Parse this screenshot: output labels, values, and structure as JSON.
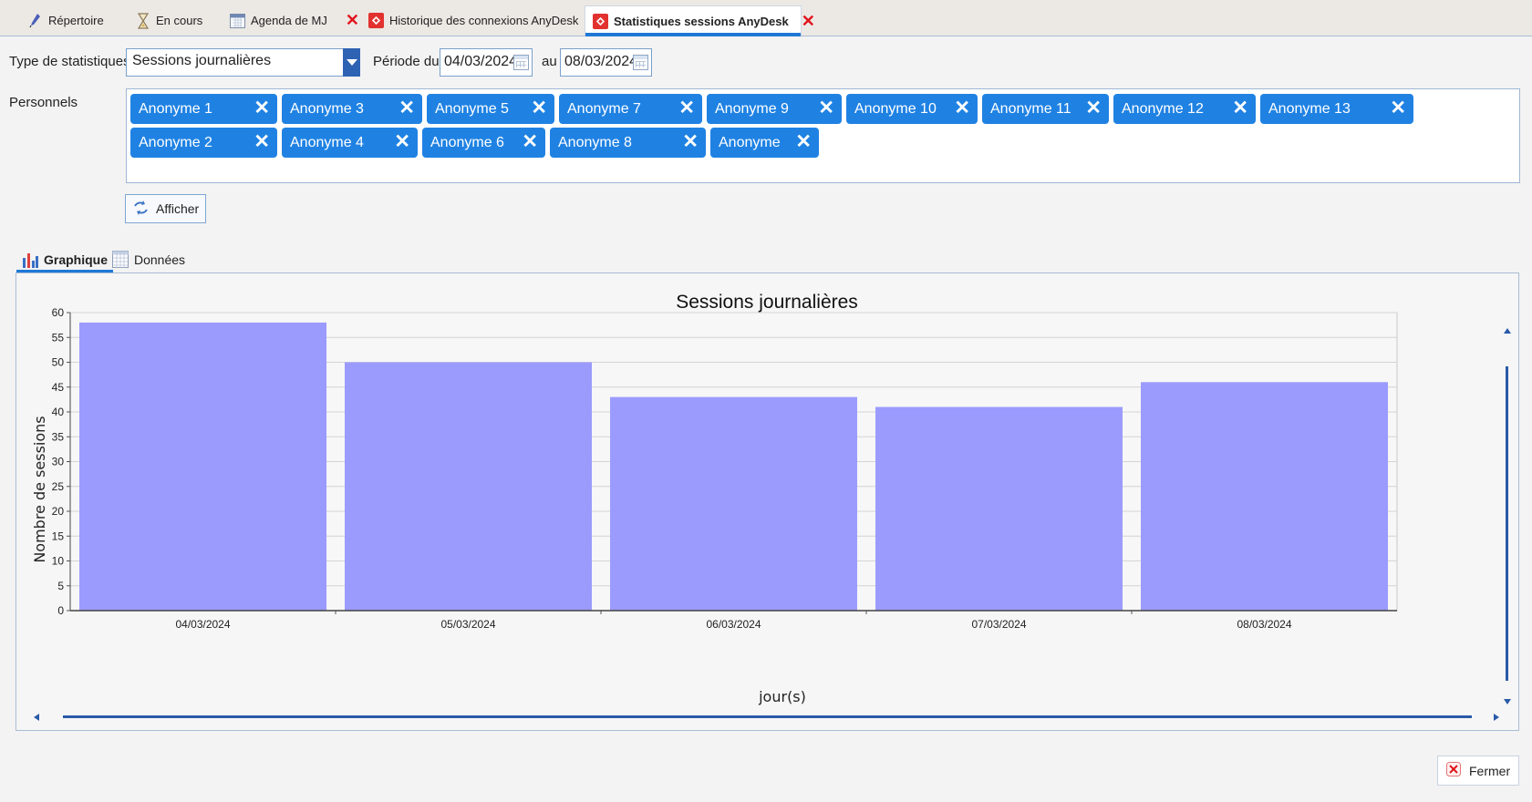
{
  "tabs": [
    {
      "label": "Répertoire",
      "icon": "pen-icon",
      "closable": false
    },
    {
      "label": "En cours",
      "icon": "hourglass-icon",
      "closable": false
    },
    {
      "label": "Agenda de MJ",
      "icon": "calendar-icon",
      "closable": true
    },
    {
      "label": "Historique des connexions AnyDesk",
      "icon": "anydesk-icon",
      "closable": true
    },
    {
      "label": "Statistiques sessions AnyDesk",
      "icon": "anydesk-icon",
      "closable": true,
      "active": true
    }
  ],
  "form": {
    "type_label": "Type de statistiques",
    "type_value": "Sessions journalières",
    "periode_label": "Période du",
    "date_from": "04/03/2024",
    "au_label": "au",
    "date_to": "08/03/2024",
    "personnels_label": "Personnels",
    "personnels_row1": [
      "Anonyme 1",
      "Anonyme 3",
      "Anonyme 5",
      "Anonyme 7",
      "Anonyme 9",
      "Anonyme 10",
      "Anonyme 11",
      "Anonyme 12",
      "Anonyme 13"
    ],
    "personnels_row2": [
      "Anonyme 2",
      "Anonyme 4",
      "Anonyme 6",
      "Anonyme 8",
      "Anonyme"
    ],
    "chip_close_glyph": "✕",
    "afficher_label": "Afficher"
  },
  "view_tabs": {
    "graphique": "Graphique",
    "donnees": "Données"
  },
  "colors": {
    "accent": "#1f78d6",
    "chip": "#1f82e3",
    "bar": "#9b9bfd",
    "close_red": "#e0141b"
  },
  "chart_data": {
    "type": "bar",
    "title": "Sessions journalières",
    "xlabel": "jour(s)",
    "ylabel": "Nombre de sessions",
    "categories": [
      "04/03/2024",
      "05/03/2024",
      "06/03/2024",
      "07/03/2024",
      "08/03/2024"
    ],
    "values": [
      58,
      50,
      43,
      41,
      46
    ],
    "ylim": [
      0,
      60
    ],
    "yticks": [
      0,
      5,
      10,
      15,
      20,
      25,
      30,
      35,
      40,
      45,
      50,
      55,
      60
    ],
    "grid": true,
    "legend": "none"
  },
  "footer": {
    "fermer_label": "Fermer"
  }
}
